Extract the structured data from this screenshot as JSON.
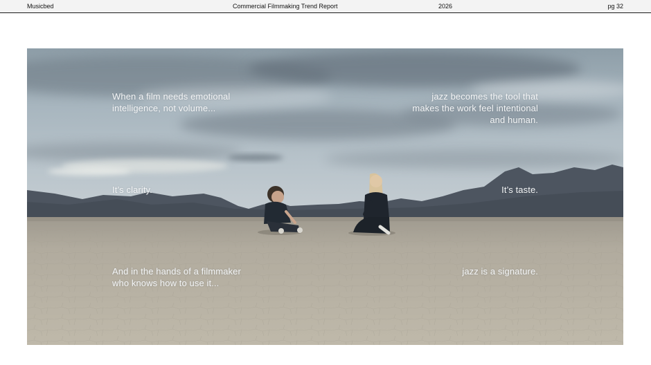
{
  "header": {
    "brand": "Musicbed",
    "title": "Commercial Filmmaking Trend Report",
    "year": "2026",
    "page": "pg 32"
  },
  "photo": {
    "captions": {
      "top_left": "When a film needs emotional intelligence, not volume...",
      "top_right": "jazz becomes the tool that makes the work feel intentional and human.",
      "middle_left": "It’s clarity.",
      "middle_right": "It’s taste.",
      "bottom_left": "And in the hands of a filmmaker who knows how to use it...",
      "bottom_right": "jazz is a signature."
    }
  },
  "colors": {
    "header_background": "#f3f3f3",
    "header_rule": "#1a1a1a",
    "caption_text": "#f4f5f6",
    "sky": "#a9b8c2",
    "salt_flat": "#b3ad9e",
    "mountains": "#4d5560"
  }
}
